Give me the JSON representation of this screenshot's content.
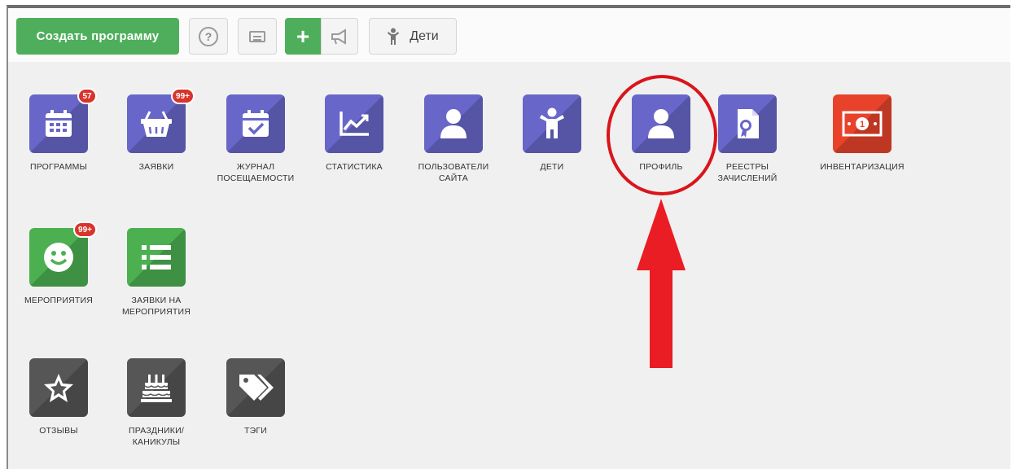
{
  "toolbar": {
    "create_label": "Создать программу",
    "help_symbol": "?",
    "plus_symbol": "+",
    "kids_label": "Дети"
  },
  "tiles": [
    {
      "label": "ПРОГРАММЫ",
      "badge": "57",
      "icon": "calendar-icon",
      "color": "#6867c9"
    },
    {
      "label": "ЗАЯВКИ",
      "badge": "99+",
      "icon": "basket-icon",
      "color": "#6867c9"
    },
    {
      "label": "ЖУРНАЛ\nПОСЕЩАЕМОСТИ",
      "badge": "",
      "icon": "calendar-check-icon",
      "color": "#6867c9"
    },
    {
      "label": "СТАТИСТИКА",
      "badge": "",
      "icon": "chart-icon",
      "color": "#6867c9"
    },
    {
      "label": "ПОЛЬЗОВАТЕЛИ\nСАЙТА",
      "badge": "",
      "icon": "user-icon",
      "color": "#6867c9"
    },
    {
      "label": "ДЕТИ",
      "badge": "",
      "icon": "child-icon",
      "color": "#6867c9"
    },
    {
      "label": "ПРОФИЛЬ",
      "badge": "",
      "icon": "user-icon",
      "color": "#6867c9"
    },
    {
      "label": "РЕЕСТРЫ\nЗАЧИСЛЕНИЙ",
      "badge": "",
      "icon": "certificate-icon",
      "color": "#6867c9"
    },
    {
      "label": "ИНВЕНТАРИЗАЦИЯ",
      "badge": "",
      "icon": "money-icon",
      "color": "#e8432a"
    },
    {
      "label": "МЕРОПРИЯТИЯ",
      "badge": "99+",
      "icon": "smile-icon",
      "color": "#4caf50"
    },
    {
      "label": "ЗАЯВКИ НА\nМЕРОПРИЯТИЯ",
      "badge": "",
      "icon": "list-icon",
      "color": "#4caf50"
    },
    {
      "label": "ОТЗЫВЫ",
      "badge": "",
      "icon": "star-icon",
      "color": "#565656"
    },
    {
      "label": "ПРАЗДНИКИ/\nКАНИКУЛЫ",
      "badge": "",
      "icon": "cake-icon",
      "color": "#565656"
    },
    {
      "label": "ТЭГИ",
      "badge": "",
      "icon": "tags-icon",
      "color": "#565656"
    }
  ],
  "tile_labels": {
    "t0": "ПРОГРАММЫ",
    "t1": "ЗАЯВКИ",
    "t2a": "ЖУРНАЛ",
    "t2b": "ПОСЕЩАЕМОСТИ",
    "t3": "СТАТИСТИКА",
    "t4a": "ПОЛЬЗОВАТЕЛИ",
    "t4b": "САЙТА",
    "t5": "ДЕТИ",
    "t6": "ПРОФИЛЬ",
    "t7a": "РЕЕСТРЫ",
    "t7b": "ЗАЧИСЛЕНИЙ",
    "t8": "ИНВЕНТАРИЗАЦИЯ",
    "t9": "МЕРОПРИЯТИЯ",
    "t10a": "ЗАЯВКИ НА",
    "t10b": "МЕРОПРИЯТИЯ",
    "t11": "ОТЗЫВЫ",
    "t12a": "ПРАЗДНИКИ/",
    "t12b": "КАНИКУЛЫ",
    "t13": "ТЭГИ"
  },
  "badges": {
    "programs": "57",
    "requests": "99+",
    "events": "99+"
  },
  "annotation": {
    "highlight_color": "#d9151c"
  }
}
